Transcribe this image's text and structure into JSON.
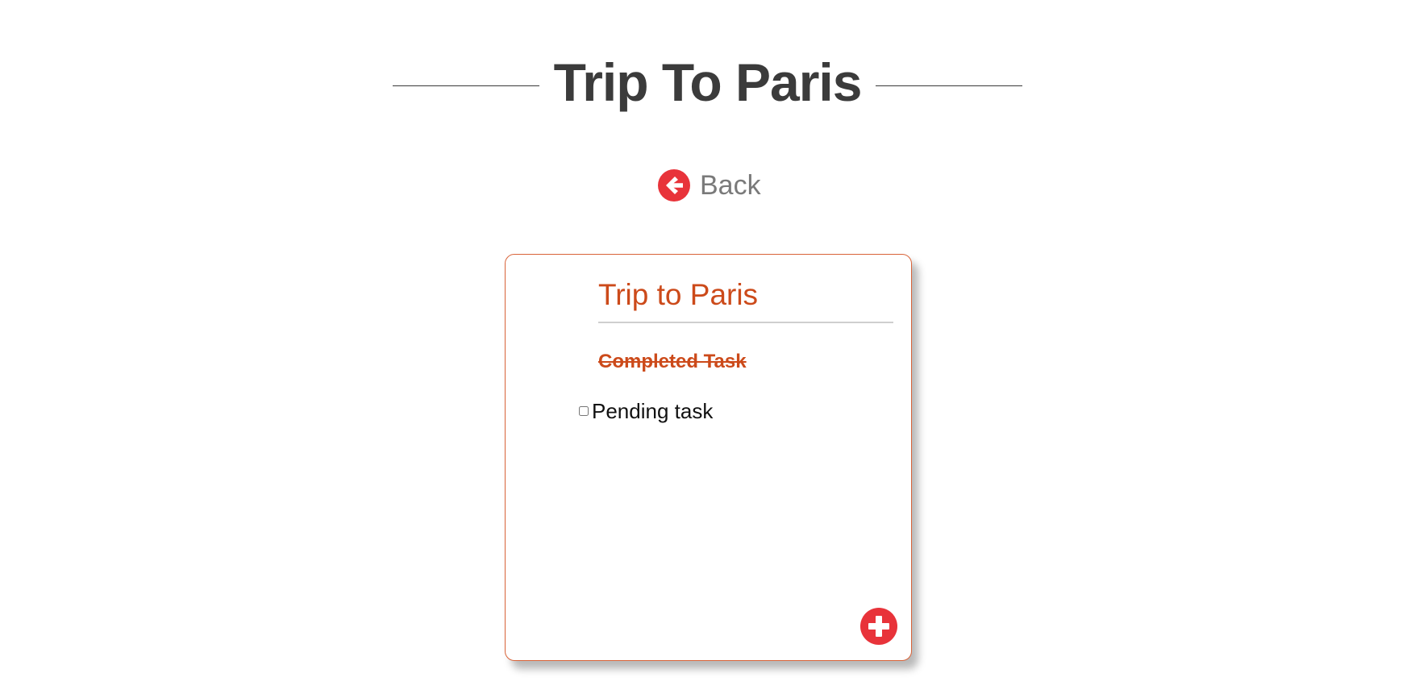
{
  "header": {
    "title": "Trip To Paris"
  },
  "navigation": {
    "back_label": "Back",
    "back_icon": "arrow-left-circle-icon"
  },
  "card": {
    "title": "Trip to Paris",
    "tasks": [
      {
        "label": "Completed Task",
        "completed": true
      },
      {
        "label": "Pending task",
        "completed": false
      }
    ],
    "add_icon": "plus-circle-icon"
  },
  "colors": {
    "accent": "#cc4a1a",
    "icon_red": "#e8333a",
    "title_text": "#3b3b3b",
    "card_border": "#d9643a"
  }
}
